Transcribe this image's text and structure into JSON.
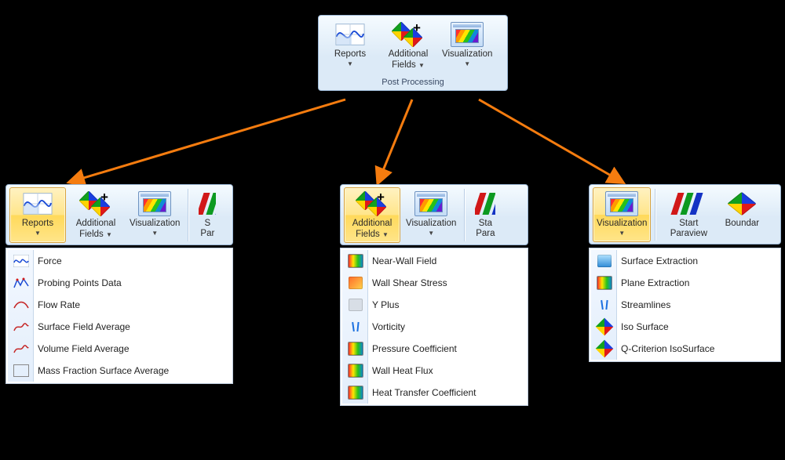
{
  "top_ribbon": {
    "caption": "Post Processing",
    "buttons": {
      "reports": {
        "label": "Reports"
      },
      "additional_fields": {
        "line1": "Additional",
        "line2": "Fields"
      },
      "visualization": {
        "label": "Visualization"
      }
    }
  },
  "panel_reports": {
    "buttons": {
      "reports": {
        "label": "Reports"
      },
      "additional_fields": {
        "line1": "Additional",
        "line2": "Fields"
      },
      "visualization": {
        "label": "Visualization"
      },
      "start_paraview_clipped": {
        "line1": "S",
        "line2": "Par"
      }
    },
    "menu": [
      "Force",
      "Probing Points Data",
      "Flow Rate",
      "Surface Field Average",
      "Volume Field Average",
      "Mass Fraction Surface Average"
    ]
  },
  "panel_fields": {
    "buttons": {
      "additional_fields": {
        "line1": "Additional",
        "line2": "Fields"
      },
      "visualization": {
        "label": "Visualization"
      },
      "start_paraview_clipped": {
        "line1": "Sta",
        "line2": "Para"
      }
    },
    "menu": [
      "Near-Wall Field",
      "Wall Shear Stress",
      "Y Plus",
      "Vorticity",
      "Pressure Coefficient",
      "Wall Heat Flux",
      "Heat Transfer Coefficient"
    ]
  },
  "panel_viz": {
    "buttons": {
      "visualization": {
        "label": "Visualization"
      },
      "start_paraview": {
        "line1": "Start",
        "line2": "Paraview"
      },
      "boundary_clipped": {
        "label": "Boundar"
      }
    },
    "menu": [
      "Surface Extraction",
      "Plane Extraction",
      "Streamlines",
      "Iso Surface",
      "Q-Criterion IsoSurface"
    ]
  },
  "colors": {
    "arrow": "#f57c0f"
  }
}
